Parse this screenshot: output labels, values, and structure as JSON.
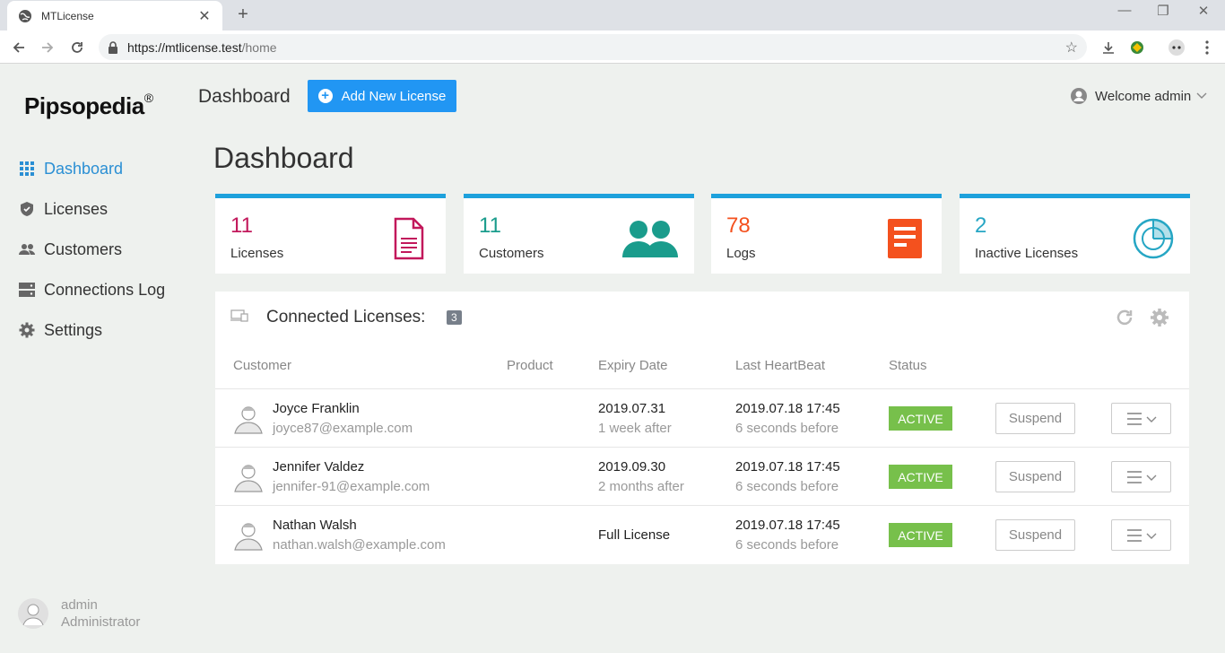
{
  "browser": {
    "tab_title": "MTLicense",
    "new_tab_symbol": "+",
    "url_host": "https://mtlicense.test",
    "url_path": "/home"
  },
  "app": {
    "logo": "Pipsopedia",
    "logo_mark": "®",
    "topbar_title": "Dashboard",
    "add_button_label": "Add New License",
    "welcome": "Welcome admin",
    "page_title": "Dashboard"
  },
  "sidebar": {
    "items": [
      {
        "label": "Dashboard",
        "icon": "grid-icon",
        "active": true
      },
      {
        "label": "Licenses",
        "icon": "shield-icon",
        "active": false
      },
      {
        "label": "Customers",
        "icon": "users-icon",
        "active": false
      },
      {
        "label": "Connections Log",
        "icon": "server-icon",
        "active": false
      },
      {
        "label": "Settings",
        "icon": "gear-icon",
        "active": false
      }
    ],
    "user": {
      "name": "admin",
      "role": "Administrator"
    }
  },
  "stats": [
    {
      "value": "11",
      "label": "Licenses",
      "color": "#c2185b",
      "icon": "document-icon"
    },
    {
      "value": "11",
      "label": "Customers",
      "color": "#1a9c8c",
      "icon": "users-icon"
    },
    {
      "value": "78",
      "label": "Logs",
      "color": "#f4511e",
      "icon": "list-icon"
    },
    {
      "value": "2",
      "label": "Inactive Licenses",
      "color": "#26a6c4",
      "icon": "pie-icon"
    }
  ],
  "panel": {
    "title": "Connected Licenses:",
    "badge": "3",
    "columns": [
      "Customer",
      "Product",
      "Expiry Date",
      "Last HeartBeat",
      "Status"
    ],
    "rows": [
      {
        "name": "Joyce Franklin",
        "email": "joyce87@example.com",
        "product": "",
        "expiry": "2019.07.31",
        "expiry_rel": "1 week after",
        "heartbeat": "2019.07.18 17:45",
        "heartbeat_rel": "6 seconds before",
        "status": "ACTIVE",
        "action": "Suspend"
      },
      {
        "name": "Jennifer Valdez",
        "email": "jennifer-91@example.com",
        "product": "",
        "expiry": "2019.09.30",
        "expiry_rel": "2 months after",
        "heartbeat": "2019.07.18 17:45",
        "heartbeat_rel": "6 seconds before",
        "status": "ACTIVE",
        "action": "Suspend"
      },
      {
        "name": "Nathan Walsh",
        "email": "nathan.walsh@example.com",
        "product": "",
        "expiry": "Full License",
        "expiry_rel": "",
        "heartbeat": "2019.07.18 17:45",
        "heartbeat_rel": "6 seconds before",
        "status": "ACTIVE",
        "action": "Suspend"
      }
    ]
  },
  "colors": {
    "accent": "#2196f3",
    "stat_bar": "#1da1dc",
    "active": "#77c04b"
  }
}
